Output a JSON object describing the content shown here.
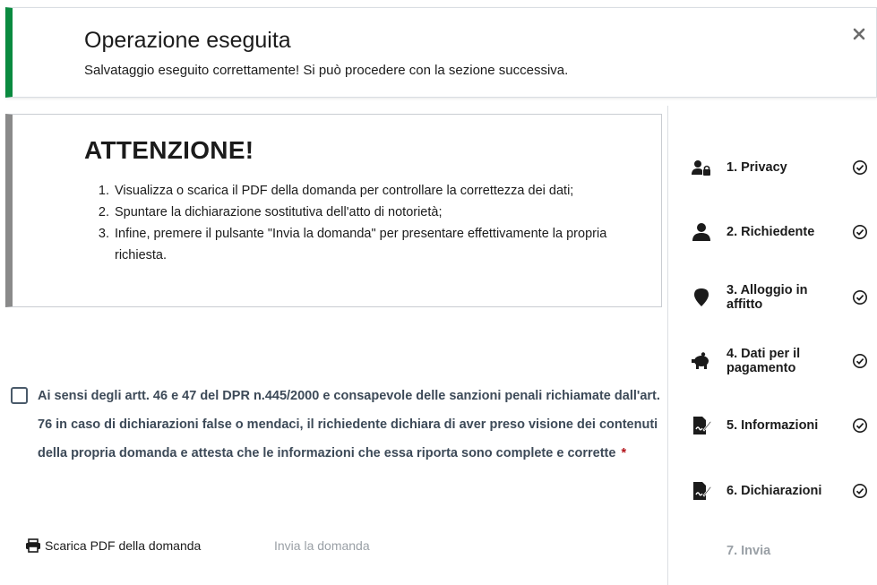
{
  "alert": {
    "title": "Operazione eseguita",
    "message": "Salvataggio eseguito correttamente! Si può procedere con la sezione successiva.",
    "accent_color": "#0a8a3f",
    "close_icon": "close-icon"
  },
  "warning": {
    "title": "ATTENZIONE!",
    "items": [
      "Visualizza o scarica il PDF della domanda per controllare la correttezza dei dati;",
      "Spuntare la dichiarazione sostitutiva dell'atto di notorietà;",
      "Infine, premere il pulsante \"Invia la domanda\" per presentare effettivamente la propria richiesta."
    ]
  },
  "declaration": {
    "text": "Ai sensi degli artt. 46 e 47 del DPR n.445/2000 e consapevole delle sanzioni penali richiamate dall'art. 76 in caso di dichiarazioni false o mendaci, il richiedente dichiara di aver preso visione dei contenuti della propria domanda e attesta che le informazioni che essa riporta sono complete e corrette",
    "required_mark": "*",
    "checked": false
  },
  "actions": {
    "download_pdf_label": "Scarica PDF della domanda",
    "download_pdf_icon": "printer-icon",
    "send_label": "Invia la domanda",
    "send_enabled": false
  },
  "stepper": {
    "steps": [
      {
        "label": "1. Privacy",
        "icon": "user-lock-icon",
        "completed": true
      },
      {
        "label": "2. Richiedente",
        "icon": "user-icon",
        "completed": true
      },
      {
        "label": "3. Alloggio in affitto",
        "icon": "map-marker-icon",
        "completed": true
      },
      {
        "label": "4. Dati per il pagamento",
        "icon": "piggy-bank-icon",
        "completed": true
      },
      {
        "label": "5. Informazioni",
        "icon": "file-signature-icon",
        "completed": true
      },
      {
        "label": "6. Dichiarazioni",
        "icon": "file-signature-icon",
        "completed": true
      },
      {
        "label": "7. Invia",
        "icon": "",
        "completed": false
      }
    ]
  }
}
